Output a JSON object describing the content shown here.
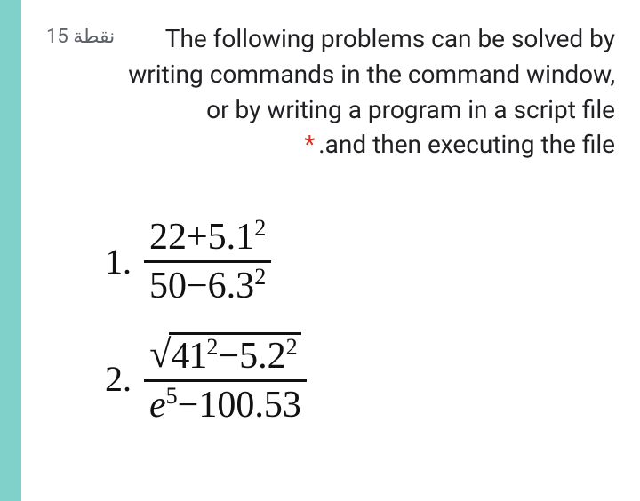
{
  "points_label": "15 نقطة",
  "question": {
    "text_lines": "The following problems can be solved by writing commands in the command window, or by writing a program in a script file .and then executing the file",
    "required_marker": "*"
  },
  "problems": [
    {
      "number": "1.",
      "numerator_plain": "22+5.1",
      "numerator_exp": "2",
      "denominator_plain": "50−6.3",
      "denominator_exp": "2"
    },
    {
      "number": "2.",
      "sqrt_a": "41",
      "sqrt_a_exp": "2",
      "sqrt_mid": "−5.2",
      "sqrt_b_exp": "2",
      "denom_e": "e",
      "denom_e_exp": "5",
      "denom_rest": "−100.53"
    }
  ]
}
